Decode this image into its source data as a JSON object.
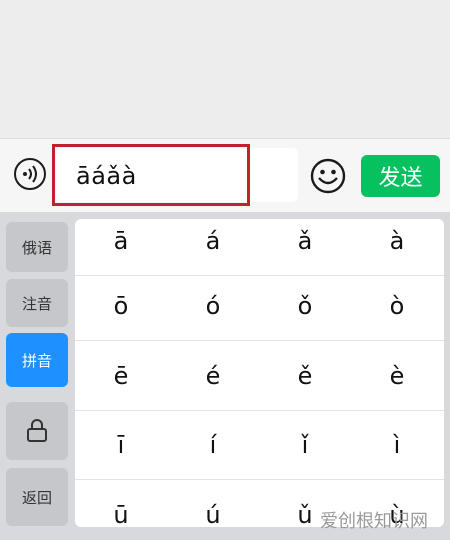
{
  "input_bar": {
    "text_value": "āáǎà",
    "send_label": "发送"
  },
  "keyboard": {
    "side_keys": [
      {
        "label": "俄语",
        "active": false
      },
      {
        "label": "注音",
        "active": false
      },
      {
        "label": "拼音",
        "active": true
      },
      {
        "label": "",
        "icon": "lock-icon",
        "active": false
      },
      {
        "label": "返回",
        "active": false
      }
    ],
    "rows": [
      [
        "ā",
        "á",
        "ǎ",
        "à"
      ],
      [
        "ō",
        "ó",
        "ǒ",
        "ò"
      ],
      [
        "ē",
        "é",
        "ě",
        "è"
      ],
      [
        "ī",
        "í",
        "ǐ",
        "ì"
      ],
      [
        "ū",
        "ú",
        "ǔ",
        "ù"
      ]
    ]
  },
  "colors": {
    "send_green": "#07c160",
    "active_blue": "#1e90ff",
    "highlight_red": "#c0222b"
  },
  "watermark": "爱创根知识网"
}
